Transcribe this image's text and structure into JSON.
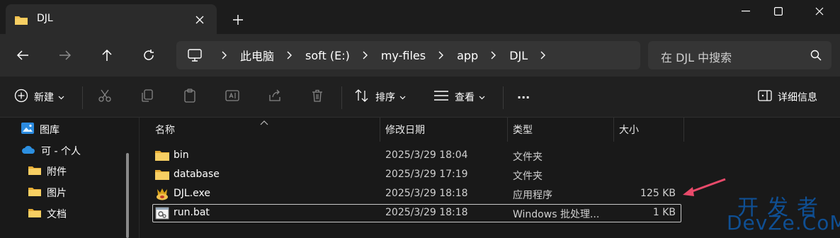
{
  "tab": {
    "title": "DJL"
  },
  "address": {
    "crumbs": [
      "此电脑",
      "soft (E:)",
      "my-files",
      "app",
      "DJL"
    ]
  },
  "search": {
    "placeholder": "在 DJL 中搜索"
  },
  "commands": {
    "new": "新建",
    "sort": "排序",
    "view": "查看",
    "more": "···",
    "details": "详细信息"
  },
  "sidebar": {
    "items": [
      {
        "label": "图库",
        "icon": "gallery-icon"
      },
      {
        "label": "可 - 个人",
        "icon": "onedrive-icon"
      },
      {
        "label": "附件",
        "icon": "folder-icon"
      },
      {
        "label": "图片",
        "icon": "folder-icon"
      },
      {
        "label": "文档",
        "icon": "folder-icon"
      }
    ]
  },
  "columns": {
    "name": "名称",
    "modified": "修改日期",
    "type": "类型",
    "size": "大小"
  },
  "files": [
    {
      "name": "bin",
      "modified": "2025/3/29 18:04",
      "type": "文件夹",
      "size": "",
      "icon": "folder-icon"
    },
    {
      "name": "database",
      "modified": "2025/3/29 17:19",
      "type": "文件夹",
      "size": "",
      "icon": "folder-icon"
    },
    {
      "name": "DJL.exe",
      "modified": "2025/3/29 18:18",
      "type": "应用程序",
      "size": "125 KB",
      "icon": "app-icon"
    },
    {
      "name": "run.bat",
      "modified": "2025/3/29 18:18",
      "type": "Windows 批处理...",
      "size": "1 KB",
      "icon": "batch-file-icon"
    }
  ],
  "watermark": {
    "top": "开发者",
    "bottom": "DevZe.CoM"
  },
  "colors": {
    "folder": "#f2c14e",
    "accent": "#e84a6a",
    "watermark": "#0f4f93"
  }
}
